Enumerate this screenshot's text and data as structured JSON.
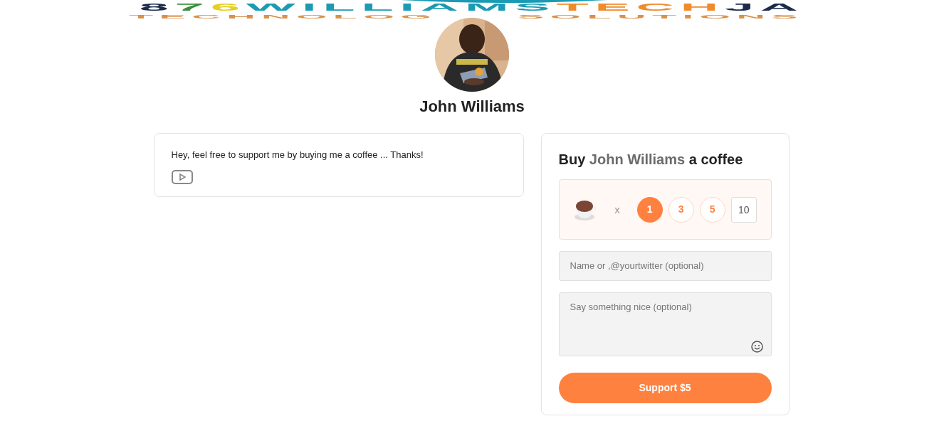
{
  "banner": {
    "title": "876WILLIAMSTECHJA",
    "subtitle_left": "TECHNOLOG",
    "subtitle_right": "SOLUTIONS"
  },
  "profile": {
    "name": "John Williams"
  },
  "about": {
    "text": "Hey, feel free to support me by buying me a coffee ... Thanks!"
  },
  "support": {
    "heading": {
      "prefix": "Buy",
      "name": "John Williams",
      "suffix": "a coffee"
    },
    "multiplier": "x",
    "options": [
      {
        "label": "1",
        "selected": true
      },
      {
        "label": "3",
        "selected": false
      },
      {
        "label": "5",
        "selected": false
      }
    ],
    "custom_amount": {
      "value": "10"
    },
    "name_field": {
      "placeholder": "Name or ,@yourtwitter (optional)"
    },
    "message_field": {
      "placeholder": "Say something nice (optional)"
    },
    "button": "Support $5"
  }
}
